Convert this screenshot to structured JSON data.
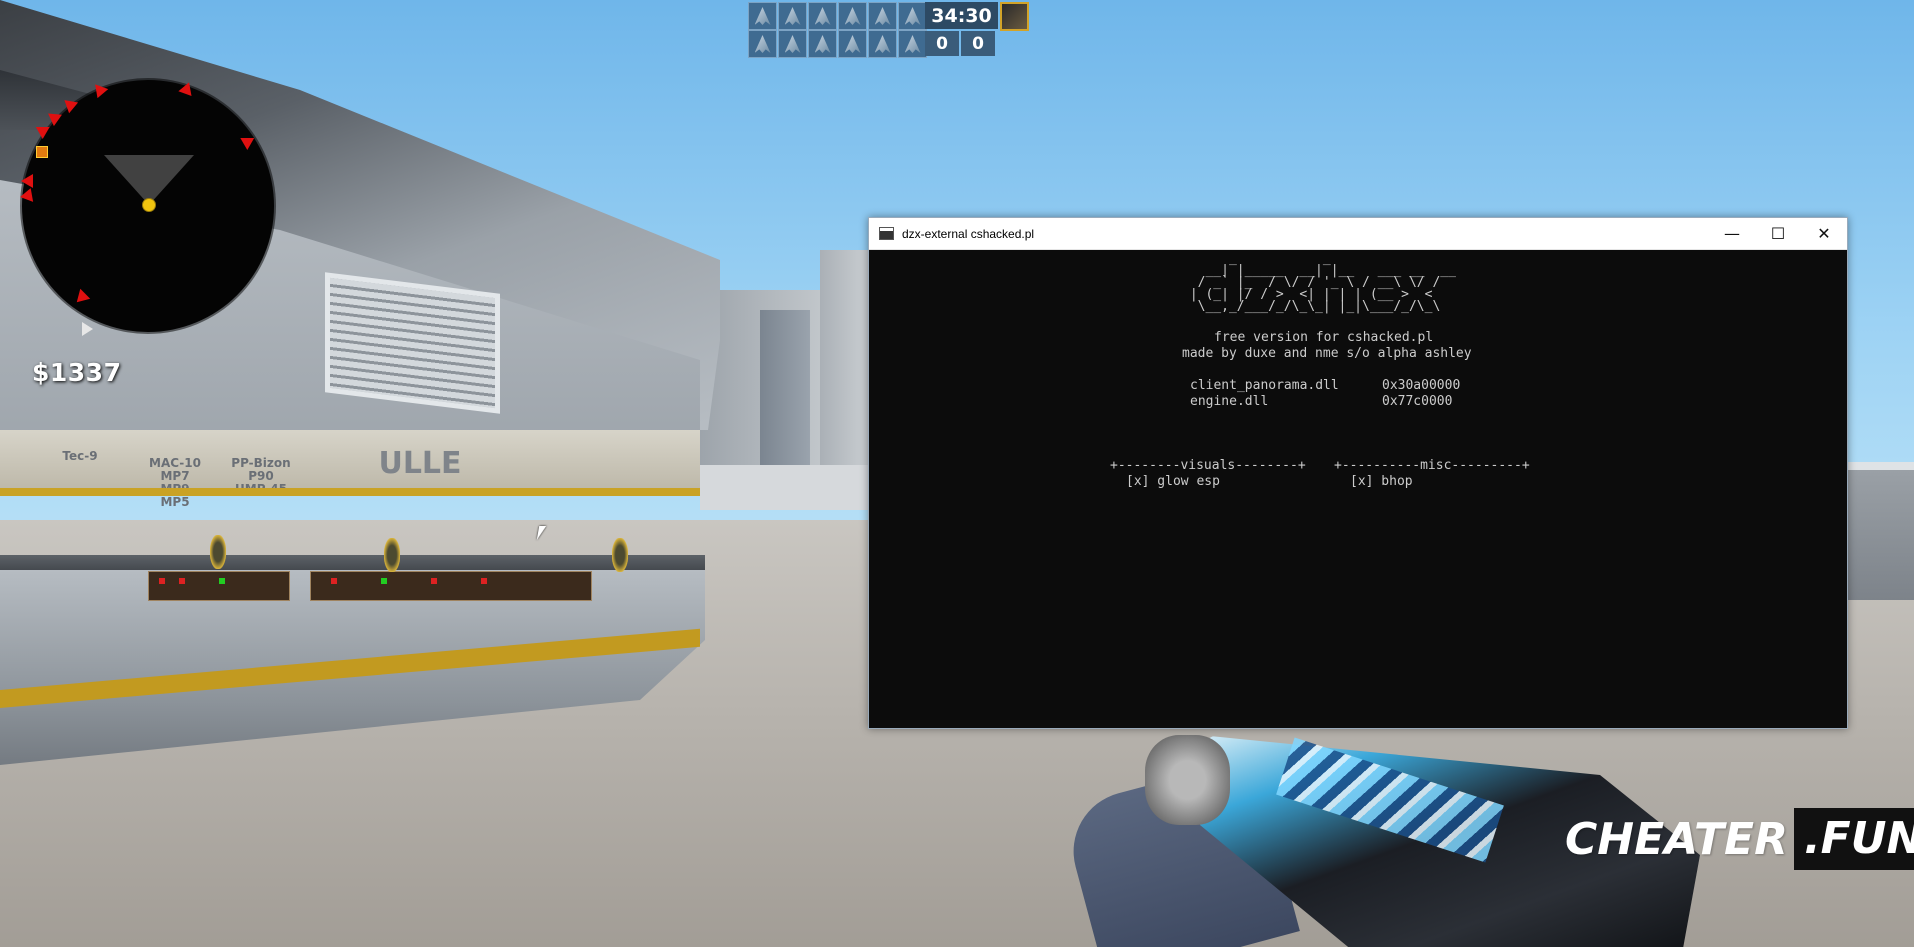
{
  "hud": {
    "timer": "34:30",
    "score_ct": "0",
    "score_t": "0",
    "money": "$1337",
    "players_top_count": 6,
    "players_bottom_count": 6
  },
  "console": {
    "title": "dzx-external cshacked.pl",
    "ascii_art": "      _           _\n   __| |_____  __| |__   ___ __  __\n  / _` |_  / \\/ / '_ \\ / __\\ \\/ /\n | (_| |/ / >  <| | | | (__ >  <\n  \\__,_/___/_/\\_\\_| |_|\\___/_/\\_\\",
    "subtitle": "free version for cshacked.pl",
    "credits": "made by duxe and nme s/o alpha ashley",
    "modules": [
      {
        "name": "client_panorama.dll",
        "address": "0x30a00000"
      },
      {
        "name": "engine.dll",
        "address": "0x77c0000"
      }
    ],
    "sections": {
      "visuals_header": "+--------visuals--------+",
      "misc_header": "+----------misc---------+",
      "visuals_item": "[x] glow esp",
      "misc_item": "[x] bhop"
    },
    "controls": {
      "minimize": "—",
      "maximize": "☐",
      "close": "✕"
    }
  },
  "shop_sign": {
    "col1": "Tec-9",
    "col2_1": "MAC-10",
    "col2_2": "MP7",
    "col2_3": "MP9",
    "col2_4": "MP5",
    "col3_1": "PP-Bizon",
    "col3_2": "P90",
    "col3_3": "UMP-45",
    "wall_text": "ULLE"
  },
  "watermark": {
    "part1": "CHEATER",
    "part2": ".FUN"
  },
  "colors": {
    "console_bg": "#0c0c0c",
    "console_text": "#cccccc",
    "hud_blue": "#3f6b91",
    "enemy_marker": "#e01010"
  }
}
